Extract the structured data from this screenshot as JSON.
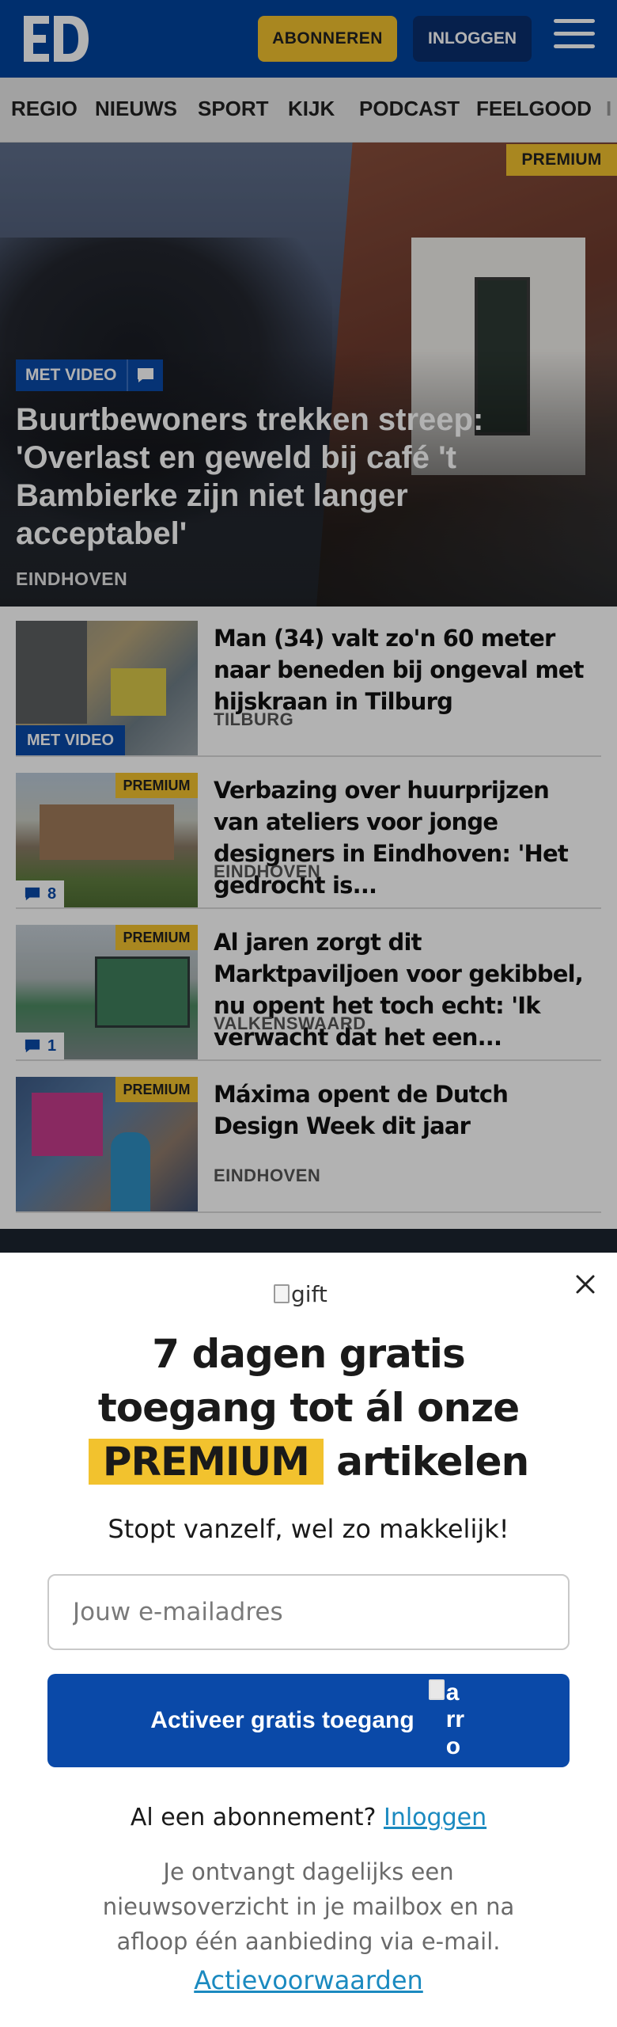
{
  "header": {
    "logo_text": "ED",
    "subscribe_label": "ABONNEREN",
    "login_label": "INLOGGEN",
    "colors": {
      "brand_blue": "#00449e",
      "accent_yellow": "#f2c22e"
    }
  },
  "nav": {
    "items": [
      {
        "label": "REGIO"
      },
      {
        "label": "NIEUWS"
      },
      {
        "label": "SPORT"
      },
      {
        "label": "KIJK"
      },
      {
        "label": "PODCAST"
      },
      {
        "label": "FEELGOOD"
      },
      {
        "label": "I"
      }
    ]
  },
  "hero": {
    "premium_label": "PREMIUM",
    "video_label": "MET VIDEO",
    "title": "Buurtbewoners trekken streep: 'Overlast en geweld bij café 't Bambierke zijn niet langer acceptabel'",
    "location": "EINDHOVEN"
  },
  "articles": [
    {
      "title": "Man (34) valt zo'n 60 meter naar beneden bij ongeval met hijskraan in Tilburg",
      "location": "TILBURG",
      "video_label": "MET VIDEO"
    },
    {
      "title": "Verbazing over huurprijzen van ateliers voor jonge designers in Eindhoven: 'Het gedrocht is...",
      "location": "EINDHOVEN",
      "premium_label": "PREMIUM",
      "comments": "8"
    },
    {
      "title": "Al jaren zorgt dit Marktpaviljoen voor gekibbel, nu opent het toch echt: 'Ik verwacht dat het een...",
      "location": "VALKENSWAARD",
      "premium_label": "PREMIUM",
      "comments": "1"
    },
    {
      "title": "Máxima opent de Dutch Design Week dit jaar",
      "location": "EINDHOVEN",
      "premium_label": "PREMIUM"
    }
  ],
  "modal": {
    "gift_alt": "gift",
    "title_line1": "7 dagen gratis",
    "title_line2": "toegang tot ál onze",
    "title_highlight": "PREMIUM",
    "title_line3_rest": "artikelen",
    "subtitle": "Stopt vanzelf, wel zo makkelijk!",
    "email_placeholder": "Jouw e-mailadres",
    "cta_label": "Activeer gratis toegang",
    "cta_icon_alt": "arrow right",
    "login_prompt": "Al een abonnement?",
    "login_link": "Inloggen",
    "info": "Je ontvangt dagelijks een nieuwsoverzicht in je mailbox en na afloop één aanbieding via e-mail.",
    "terms_link": "Actievoorwaarden"
  }
}
